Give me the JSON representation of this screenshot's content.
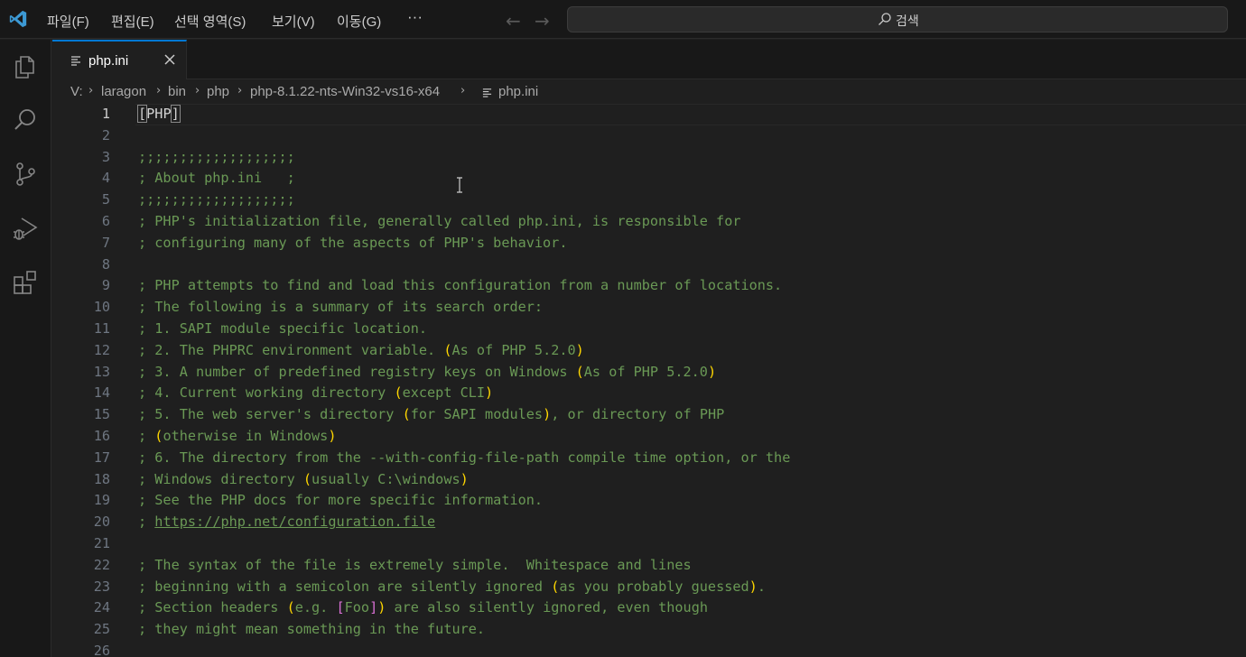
{
  "menu": {
    "items": [
      "파일(F)",
      "편집(E)",
      "선택 영역(S)",
      "보기(V)",
      "이동(G)"
    ],
    "more": "···",
    "back_icon": "arrow-left-icon",
    "forward_icon": "arrow-right-icon"
  },
  "search": {
    "label": "검색",
    "icon": "search-icon"
  },
  "activity_bar": {
    "items": [
      "explorer-icon",
      "search-icon",
      "source-control-icon",
      "run-debug-icon",
      "extensions-icon"
    ]
  },
  "tab": {
    "label": "php.ini",
    "close": "close-icon"
  },
  "breadcrumb": [
    "V:",
    "laragon",
    "bin",
    "php",
    "php-8.1.22-nts-Win32-vs16-x64",
    "php.ini"
  ],
  "editor": {
    "active_line": 1,
    "lines": [
      {
        "n": "1",
        "t": "[PHP]"
      },
      {
        "n": "2",
        "t": ""
      },
      {
        "n": "3",
        "t": ";;;;;;;;;;;;;;;;;;;"
      },
      {
        "n": "4",
        "t": "; About php.ini   ;"
      },
      {
        "n": "5",
        "t": ";;;;;;;;;;;;;;;;;;;"
      },
      {
        "n": "6",
        "t": "; PHP's initialization file, generally called php.ini, is responsible for"
      },
      {
        "n": "7",
        "t": "; configuring many of the aspects of PHP's behavior."
      },
      {
        "n": "8",
        "t": ""
      },
      {
        "n": "9",
        "t": "; PHP attempts to find and load this configuration from a number of locations."
      },
      {
        "n": "10",
        "t": "; The following is a summary of its search order:"
      },
      {
        "n": "11",
        "t": "; 1. SAPI module specific location."
      },
      {
        "n": "12",
        "t": "; 2. The PHPRC environment variable. (As of PHP 5.2.0)"
      },
      {
        "n": "13",
        "t": "; 3. A number of predefined registry keys on Windows (As of PHP 5.2.0)"
      },
      {
        "n": "14",
        "t": "; 4. Current working directory (except CLI)"
      },
      {
        "n": "15",
        "t": "; 5. The web server's directory (for SAPI modules), or directory of PHP"
      },
      {
        "n": "16",
        "t": "; (otherwise in Windows)"
      },
      {
        "n": "17",
        "t": "; 6. The directory from the --with-config-file-path compile time option, or the"
      },
      {
        "n": "18",
        "t": "; Windows directory (usually C:\\windows)"
      },
      {
        "n": "19",
        "t": "; See the PHP docs for more specific information."
      },
      {
        "n": "20",
        "t": "; https://php.net/configuration.file"
      },
      {
        "n": "21",
        "t": ""
      },
      {
        "n": "22",
        "t": "; The syntax of the file is extremely simple.  Whitespace and lines"
      },
      {
        "n": "23",
        "t": "; beginning with a semicolon are silently ignored (as you probably guessed)."
      },
      {
        "n": "24",
        "t": "; Section headers (e.g. [Foo]) are also silently ignored, even though"
      },
      {
        "n": "25",
        "t": "; they might mean something in the future."
      },
      {
        "n": "26",
        "t": ""
      }
    ]
  },
  "colors": {
    "comment": "#6a9955",
    "bracket": "#ffd700",
    "bracket_nested": "#da70d6",
    "accent": "#0078d4"
  }
}
